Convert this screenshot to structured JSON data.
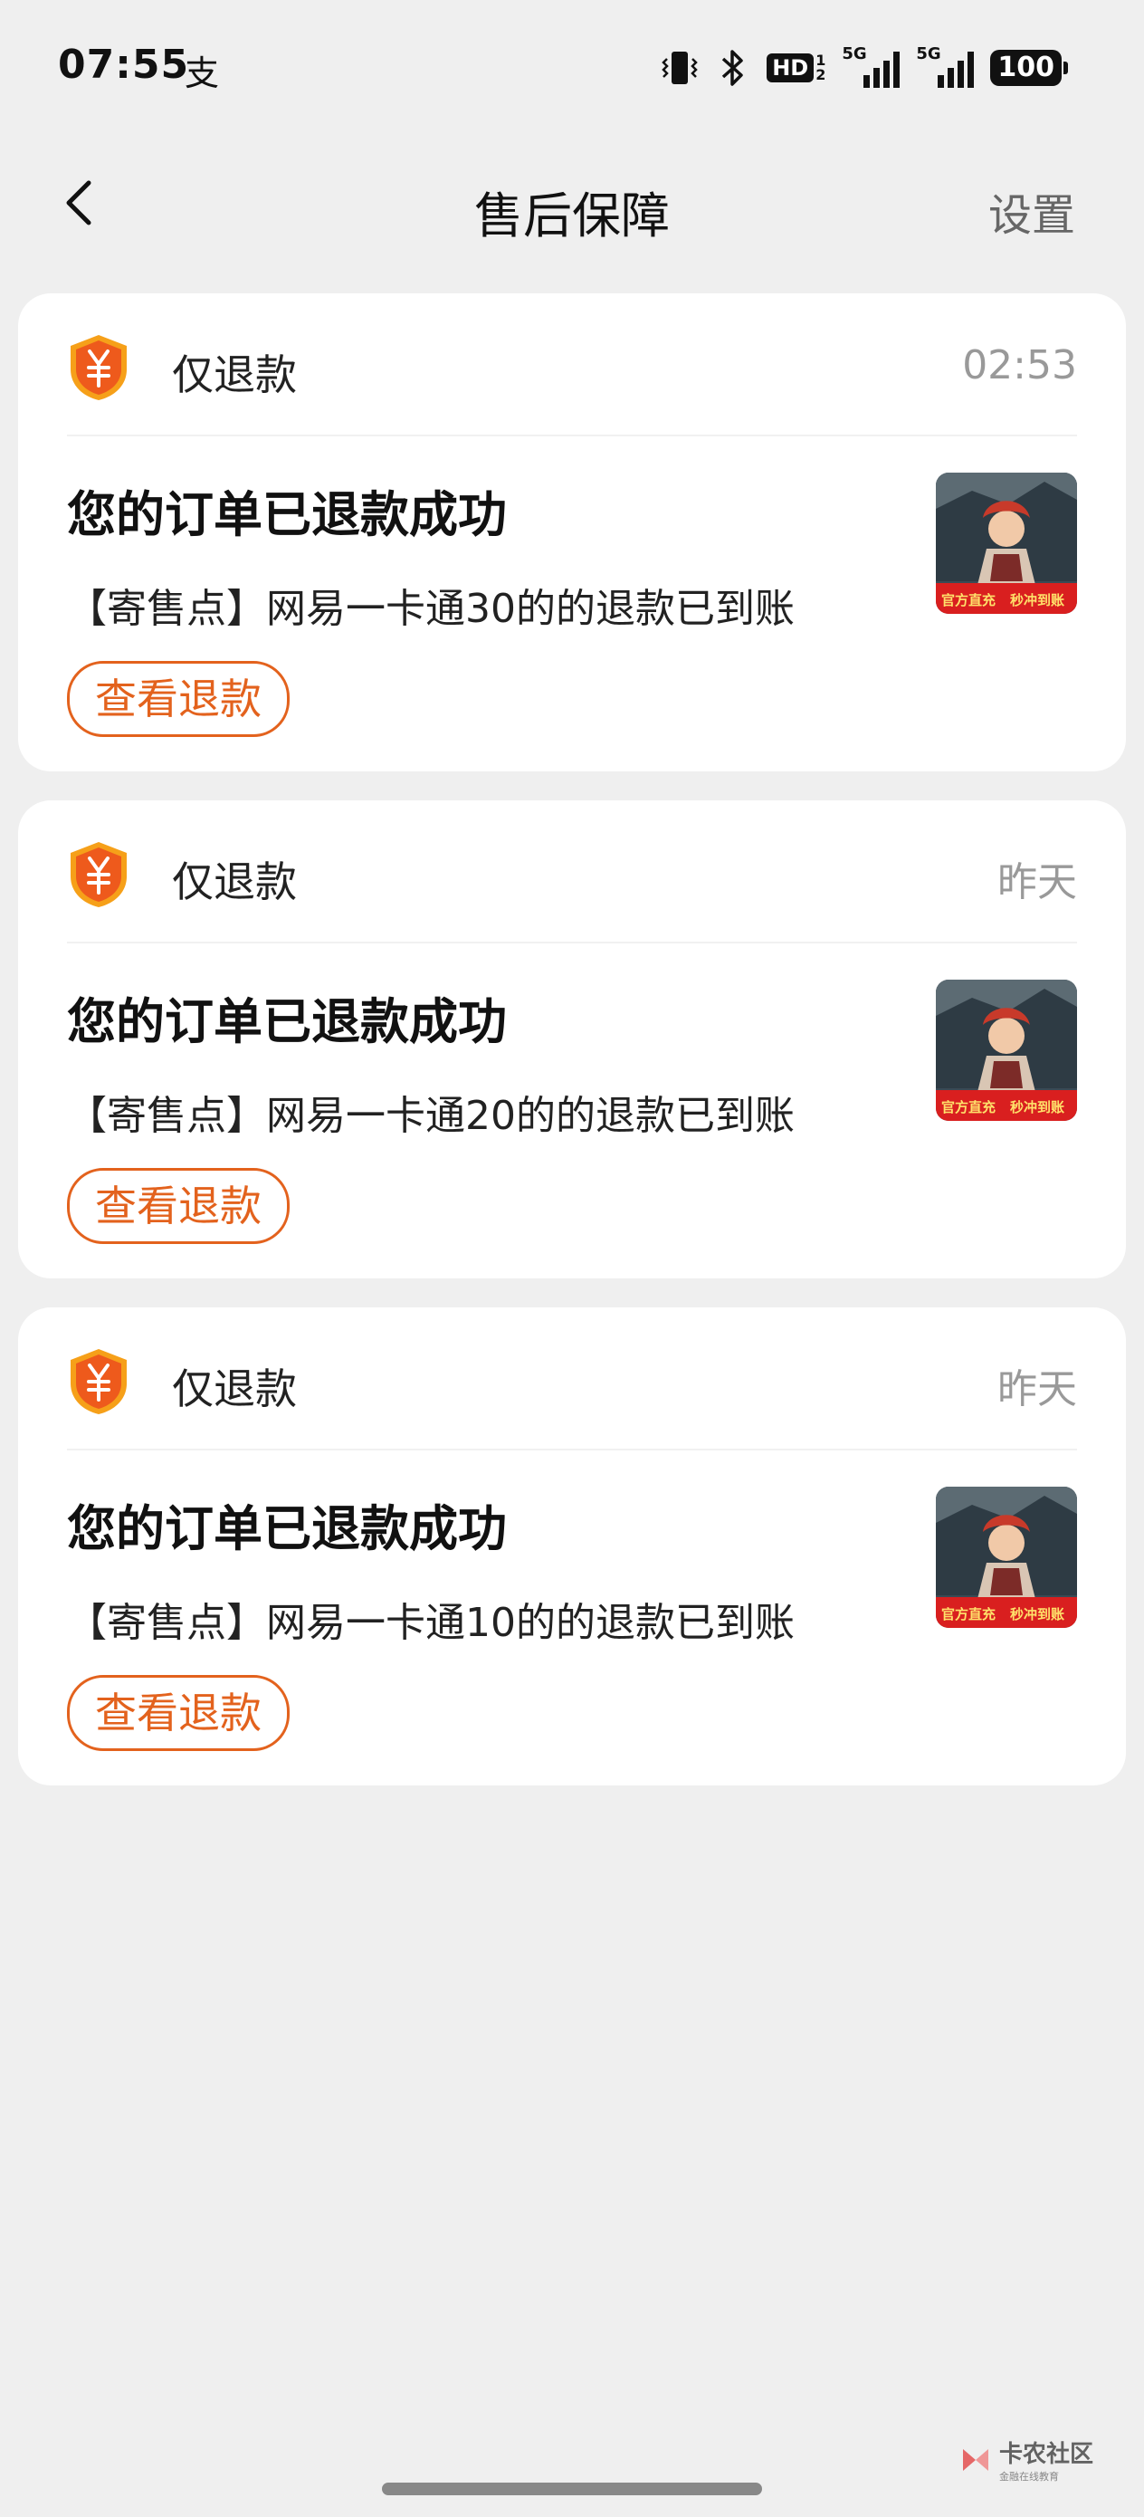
{
  "status_bar": {
    "time": "07:55",
    "app_icon": "支",
    "hd_label": "HD",
    "hd_sub_top": "1",
    "hd_sub_bottom": "2",
    "sim1_label": "5G",
    "sim2_label": "5G",
    "battery": "100"
  },
  "header": {
    "title": "售后保障",
    "settings_label": "设置"
  },
  "cards": [
    {
      "type": "仅退款",
      "time": "02:53",
      "title": "您的订单已退款成功",
      "desc": "【寄售点】网易一卡通30的的退款已到账",
      "button": "查看退款"
    },
    {
      "type": "仅退款",
      "time": "昨天",
      "title": "您的订单已退款成功",
      "desc": "【寄售点】网易一卡通20的的退款已到账",
      "button": "查看退款"
    },
    {
      "type": "仅退款",
      "time": "昨天",
      "title": "您的订单已退款成功",
      "desc": "【寄售点】网易一卡通10的的退款已到账",
      "button": "查看退款"
    }
  ],
  "product_image": {
    "banner_left": "官方直充",
    "banner_right": "秒冲到账"
  },
  "watermark": {
    "name": "卡农社区",
    "slogan": "金融在线教育"
  },
  "colors": {
    "accent": "#e3621d",
    "background": "#efefef",
    "card": "#ffffff",
    "muted": "#999999"
  },
  "icons": {
    "back": "chevron-left-icon",
    "refund": "yuan-shield-icon",
    "vibrate": "vibrate-icon",
    "bluetooth": "bluetooth-icon"
  }
}
